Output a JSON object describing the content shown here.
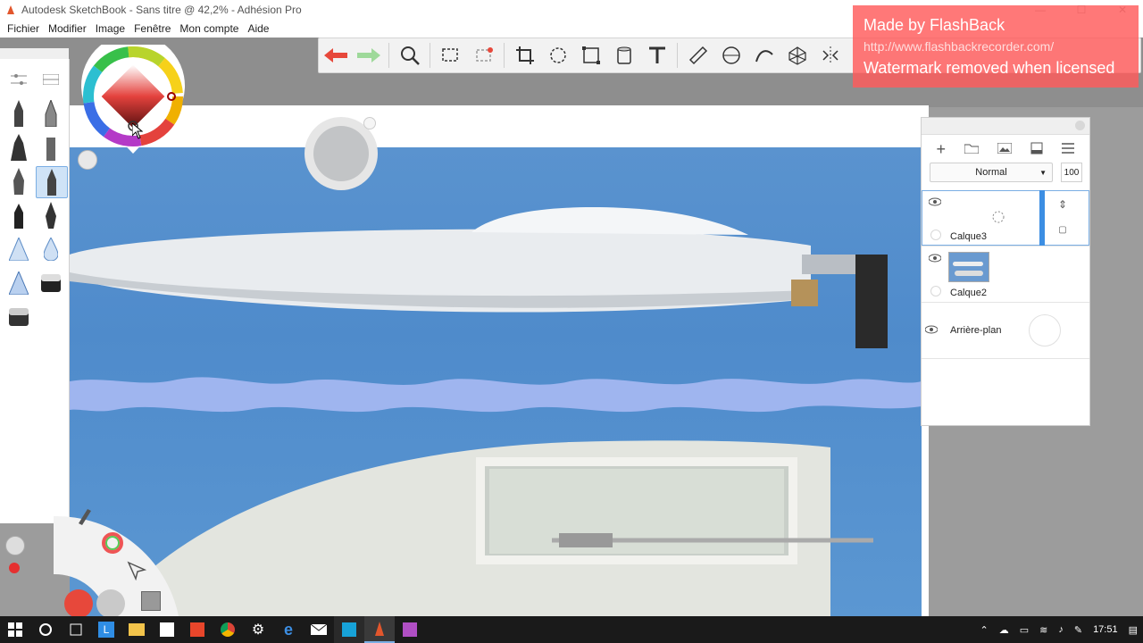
{
  "window": {
    "title": "Autodesk SketchBook - Sans titre @ 42,2% - Adhésion Pro",
    "controls": [
      "—",
      "☐",
      "✕"
    ]
  },
  "menu": {
    "items": [
      "Fichier",
      "Modifier",
      "Image",
      "Fenêtre",
      "Mon compte",
      "Aide"
    ]
  },
  "watermark": {
    "line1": "Made by FlashBack",
    "line2": "http://www.flashbackrecorder.com/",
    "line3": "Watermark removed when licensed"
  },
  "toolbar": {
    "icons": [
      "undo-icon",
      "redo-icon",
      "zoom-icon",
      "select-icon",
      "lasso-select-icon",
      "crop-icon",
      "transform-icon",
      "distort-icon",
      "fill-bucket-icon",
      "text-icon",
      "ruler-icon",
      "ellipse-guide-icon",
      "french-curve-icon",
      "perspective-icon",
      "symmetry-icon"
    ]
  },
  "layers": {
    "blend_mode": "Normal",
    "opacity": "100",
    "items": [
      {
        "name": "Calque3",
        "selected": true
      },
      {
        "name": "Calque2",
        "selected": false
      },
      {
        "name": "Arrière-plan",
        "selected": false
      }
    ]
  },
  "taskbar": {
    "time": "17:51"
  },
  "colors": {
    "accent": "#3c8ee3",
    "undo_red": "#e7483b",
    "watermark": "#ff5a5a"
  }
}
